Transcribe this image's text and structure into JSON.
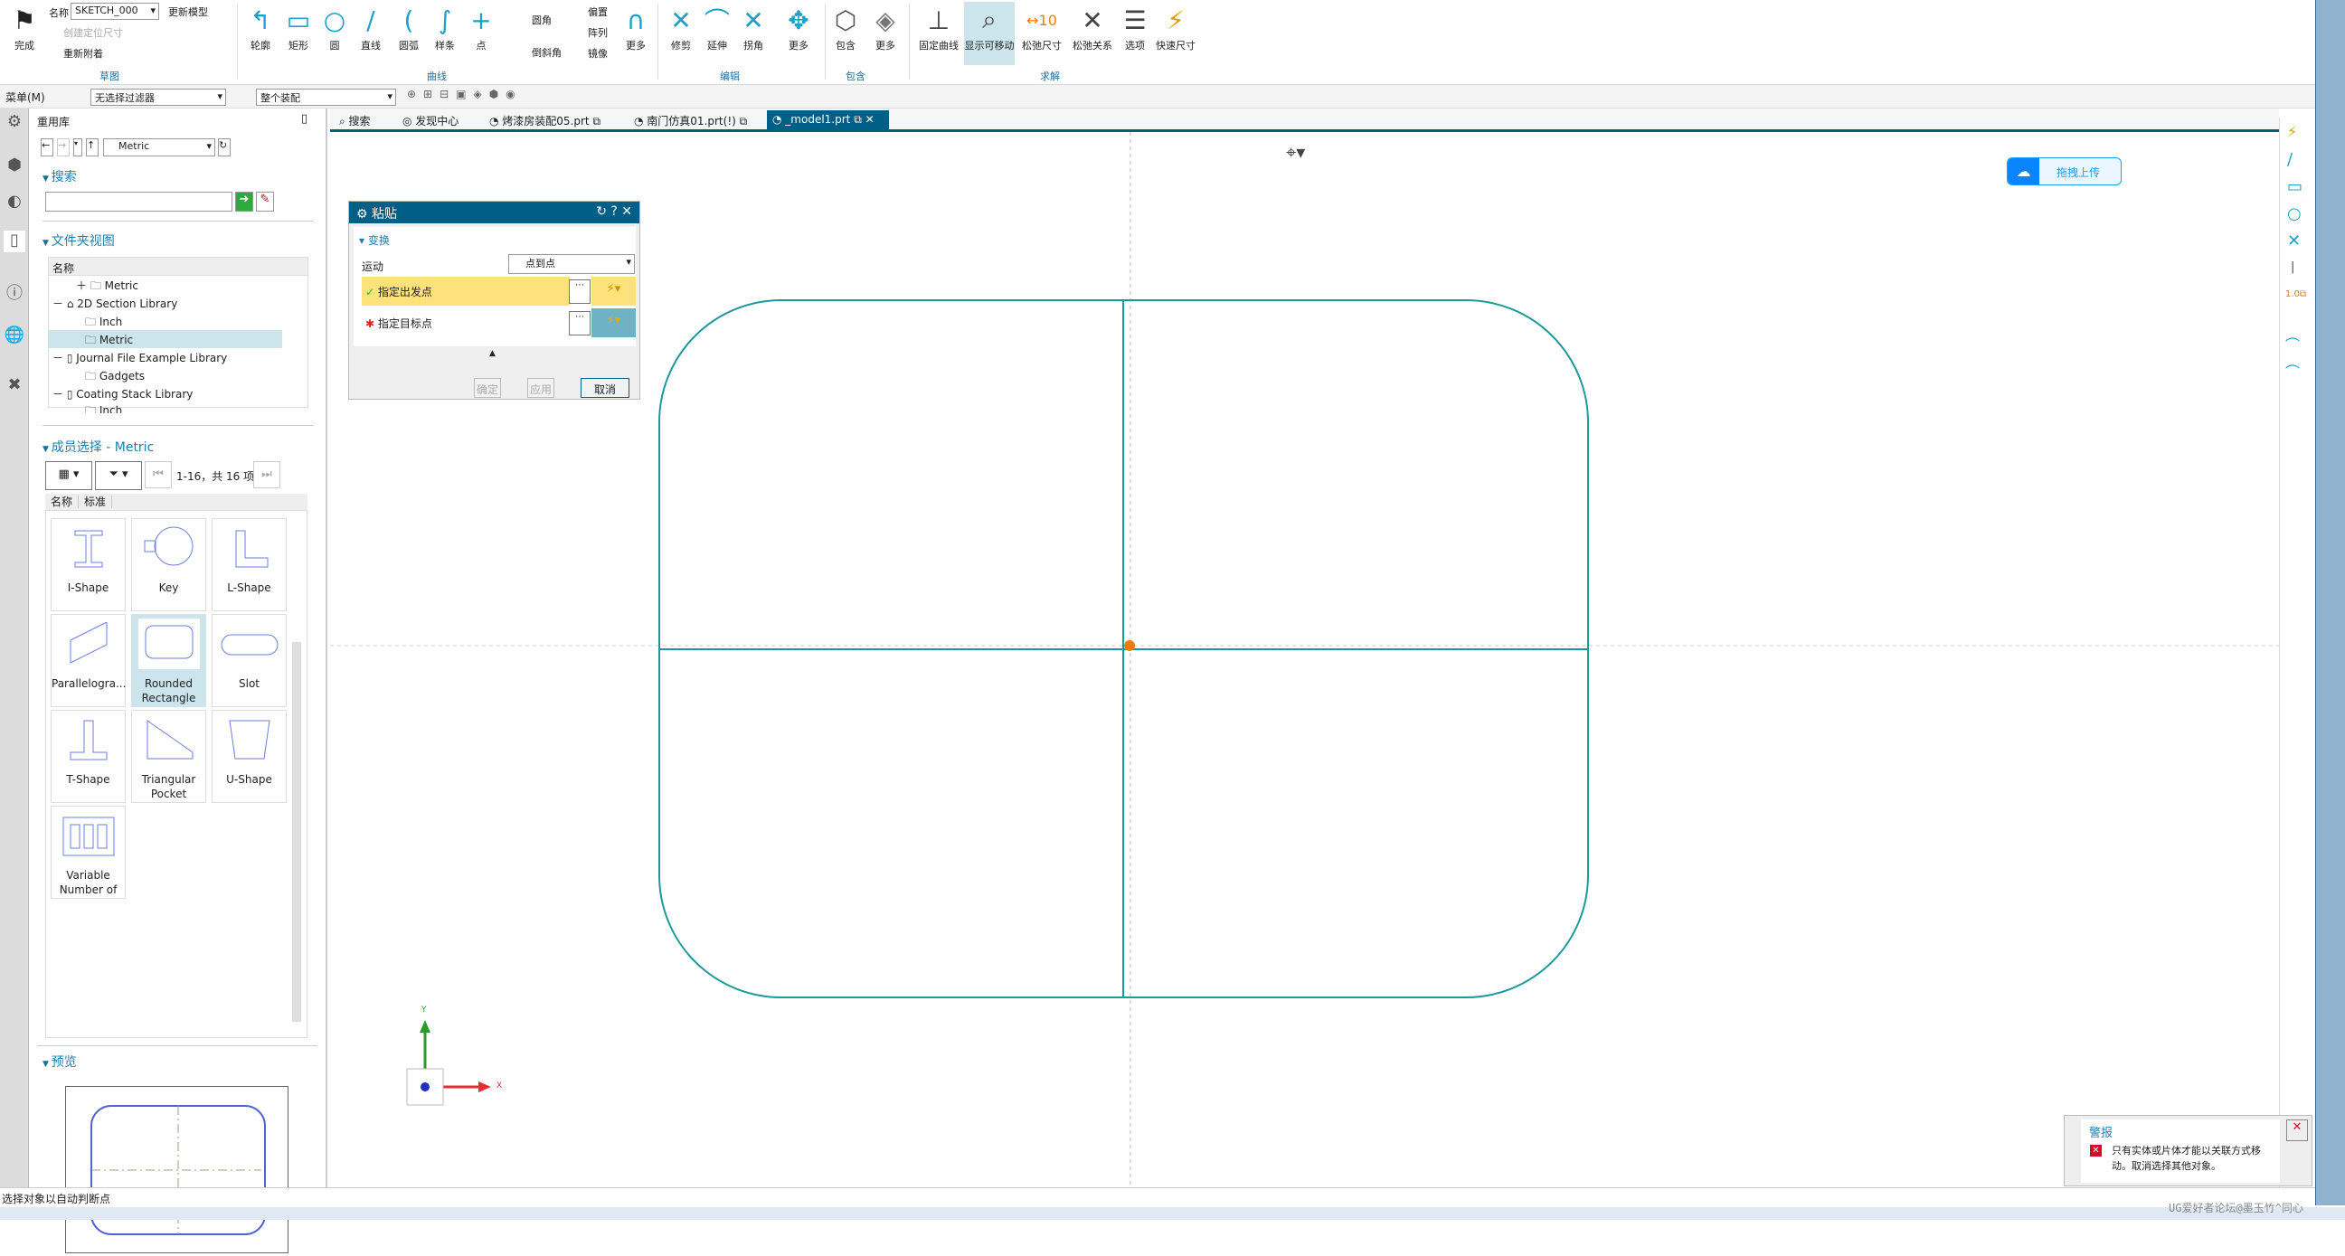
{
  "ribbon": {
    "finish": "完成",
    "name_label": "名称",
    "sketch_name": "SKETCH_000",
    "update_model": "更新模型",
    "create_dim": "创建定位尺寸",
    "reattach": "重新附着",
    "curve_tools": [
      "轮廓",
      "矩形",
      "圆",
      "直线",
      "圆弧",
      "样条",
      "点"
    ],
    "fillet": "圆角",
    "chamfer": "倒斜角",
    "offset": "偏置",
    "pattern": "阵列",
    "mirror": "镜像",
    "more": "更多",
    "edit_tools": [
      "修剪",
      "延伸",
      "拐角",
      "更多"
    ],
    "include_tools": [
      "包含",
      "更多"
    ],
    "solve_tools": [
      "固定曲线",
      "显示可移动",
      "松弛尺寸",
      "松弛关系",
      "选项",
      "快速尺寸"
    ],
    "groups": [
      "草图",
      "曲线",
      "编辑",
      "包含",
      "求解"
    ]
  },
  "toolbar": {
    "menu": "菜单(M)",
    "filter": "无选择过滤器",
    "assembly": "整个装配"
  },
  "tabs": [
    {
      "label": "搜索"
    },
    {
      "label": "发现中心"
    },
    {
      "label": "烤漆房装配05.prt"
    },
    {
      "label": "南门仿真01.prt(!)"
    },
    {
      "label": "_model1.prt"
    }
  ],
  "panel": {
    "title": "重用库",
    "path": "Metric",
    "search_section": "搜索",
    "search_value": "",
    "folder_section": "文件夹视图",
    "col_name": "名称",
    "tree": [
      "Metric",
      "2D Section Library",
      "Inch",
      "Metric",
      "Journal File Example Library",
      "Gadgets",
      "Coating Stack Library",
      "Inch"
    ],
    "member_section": "成员选择 - Metric",
    "pager": "1-16，共 16 项",
    "cols": [
      "名称",
      "标准"
    ],
    "members": [
      "I-Shape",
      "Key",
      "L-Shape",
      "Parallelogra...",
      "Rounded Rectangle",
      "Slot",
      "T-Shape",
      "Triangular Pocket",
      "U-Shape",
      "Variable Number of"
    ],
    "selected_member": "Rounded Rectangle",
    "preview_section": "预览"
  },
  "dialog": {
    "title": "粘贴",
    "section": "变换",
    "motion_label": "运动",
    "motion_value": "点到点",
    "from_point": "指定出发点",
    "to_point": "指定目标点",
    "ok": "确定",
    "apply": "应用",
    "cancel": "取消"
  },
  "viewport": {
    "upload": "拖拽上传",
    "axis_x": "X",
    "axis_y": "Y",
    "colors": {
      "sketch": "#1a9a9a",
      "point": "#f07d00"
    }
  },
  "alert": {
    "title": "警报",
    "message": "只有实体或片体才能以关联方式移动。取消选择其他对象。"
  },
  "status": "选择对象以自动判断点",
  "watermark": "UG爱好者论坛@墨玉竹^同心"
}
